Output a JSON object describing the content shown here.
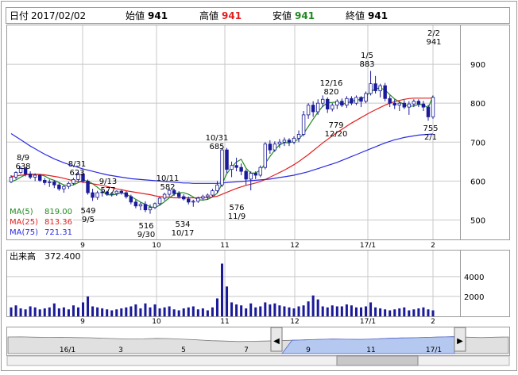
{
  "header": {
    "date_label": "日付",
    "date": "2017/02/02",
    "open_label": "始値",
    "open": "941",
    "high_label": "高値",
    "high": "941",
    "low_label": "安値",
    "low": "941",
    "close_label": "終値",
    "close": "941"
  },
  "colors": {
    "up_candle": "#ffffff",
    "down_candle": "#1a1a9a",
    "candle_outline": "#1a1a9a",
    "ma5": "#1f8a1f",
    "ma25": "#e02020",
    "ma75": "#2a2ae0",
    "volume_bar": "#1a1a9a",
    "high_value": "#e02020",
    "low_value": "#1f8a1f",
    "grid": "#c8c8c8",
    "navigator_fill": "#b4c8f0"
  },
  "chart_data": [
    {
      "type": "candlestick",
      "title": "",
      "ylim": [
        450,
        1000
      ],
      "yticks": [
        "500",
        "600",
        "700",
        "800",
        "900"
      ],
      "xticks": [
        "9",
        "10",
        "11",
        "12",
        "17/1",
        "2"
      ],
      "grid": true,
      "legend_position": "bottom-left",
      "legend": [
        {
          "name": "MA(5)",
          "value": "819.00"
        },
        {
          "name": "MA(25)",
          "value": "813.36"
        },
        {
          "name": "MA(75)",
          "value": "721.31"
        }
      ],
      "ohlc": [
        [
          598,
          615,
          595,
          610
        ],
        [
          610,
          625,
          605,
          622
        ],
        [
          622,
          638,
          618,
          632
        ],
        [
          632,
          636,
          612,
          618
        ],
        [
          618,
          625,
          605,
          610
        ],
        [
          610,
          620,
          600,
          615
        ],
        [
          615,
          618,
          598,
          602
        ],
        [
          602,
          608,
          590,
          596
        ],
        [
          596,
          604,
          585,
          598
        ],
        [
          598,
          602,
          582,
          590
        ],
        [
          590,
          596,
          575,
          580
        ],
        [
          580,
          590,
          570,
          586
        ],
        [
          586,
          598,
          580,
          594
        ],
        [
          594,
          608,
          590,
          604
        ],
        [
          604,
          623,
          600,
          618
        ],
        [
          618,
          622,
          595,
          600
        ],
        [
          600,
          604,
          565,
          570
        ],
        [
          570,
          580,
          549,
          558
        ],
        [
          558,
          575,
          552,
          570
        ],
        [
          570,
          577,
          560,
          572
        ],
        [
          572,
          575,
          562,
          566
        ],
        [
          566,
          572,
          560,
          568
        ],
        [
          568,
          576,
          562,
          574
        ],
        [
          574,
          577,
          565,
          570
        ],
        [
          570,
          574,
          555,
          560
        ],
        [
          560,
          565,
          540,
          546
        ],
        [
          546,
          552,
          530,
          536
        ],
        [
          536,
          545,
          525,
          540
        ],
        [
          540,
          548,
          520,
          526
        ],
        [
          526,
          540,
          516,
          532
        ],
        [
          532,
          545,
          528,
          542
        ],
        [
          542,
          560,
          538,
          556
        ],
        [
          556,
          570,
          550,
          566
        ],
        [
          566,
          582,
          560,
          576
        ],
        [
          576,
          580,
          562,
          568
        ],
        [
          568,
          574,
          555,
          560
        ],
        [
          560,
          566,
          550,
          554
        ],
        [
          554,
          560,
          540,
          546
        ],
        [
          546,
          552,
          534,
          548
        ],
        [
          548,
          560,
          544,
          556
        ],
        [
          556,
          565,
          550,
          560
        ],
        [
          560,
          568,
          552,
          564
        ],
        [
          564,
          580,
          560,
          575
        ],
        [
          575,
          600,
          570,
          590
        ],
        [
          590,
          685,
          585,
          680
        ],
        [
          680,
          685,
          620,
          630
        ],
        [
          630,
          650,
          610,
          640
        ],
        [
          640,
          660,
          625,
          635
        ],
        [
          635,
          645,
          615,
          625
        ],
        [
          625,
          630,
          590,
          605
        ],
        [
          605,
          625,
          576,
          620
        ],
        [
          620,
          625,
          605,
          615
        ],
        [
          615,
          640,
          610,
          635
        ],
        [
          635,
          700,
          630,
          695
        ],
        [
          695,
          705,
          670,
          680
        ],
        [
          680,
          702,
          675,
          695
        ],
        [
          695,
          708,
          685,
          700
        ],
        [
          700,
          712,
          690,
          705
        ],
        [
          705,
          710,
          690,
          700
        ],
        [
          700,
          715,
          695,
          710
        ],
        [
          710,
          730,
          700,
          720
        ],
        [
          720,
          780,
          715,
          770
        ],
        [
          770,
          800,
          760,
          795
        ],
        [
          795,
          805,
          765,
          778
        ],
        [
          778,
          810,
          770,
          800
        ],
        [
          800,
          820,
          790,
          810
        ],
        [
          810,
          815,
          775,
          785
        ],
        [
          785,
          800,
          779,
          795
        ],
        [
          795,
          810,
          785,
          805
        ],
        [
          805,
          812,
          790,
          795
        ],
        [
          795,
          818,
          788,
          812
        ],
        [
          812,
          818,
          795,
          800
        ],
        [
          800,
          820,
          795,
          815
        ],
        [
          815,
          818,
          790,
          805
        ],
        [
          805,
          830,
          800,
          825
        ],
        [
          825,
          883,
          820,
          850
        ],
        [
          850,
          870,
          825,
          832
        ],
        [
          832,
          850,
          815,
          845
        ],
        [
          845,
          852,
          805,
          812
        ],
        [
          812,
          820,
          790,
          800
        ],
        [
          800,
          810,
          785,
          795
        ],
        [
          795,
          805,
          780,
          800
        ],
        [
          800,
          808,
          785,
          790
        ],
        [
          790,
          805,
          770,
          798
        ],
        [
          798,
          810,
          790,
          805
        ],
        [
          805,
          810,
          790,
          798
        ],
        [
          798,
          806,
          780,
          790
        ],
        [
          790,
          796,
          755,
          765
        ],
        [
          765,
          820,
          760,
          815
        ]
      ],
      "series": [
        {
          "name": "MA(5)",
          "values": [
            598,
            603,
            610,
            616,
            618,
            617,
            617,
            613,
            606,
            602,
            596,
            590,
            589,
            590,
            596,
            602,
            600,
            593,
            584,
            574,
            565,
            564,
            566,
            570,
            566,
            560,
            553,
            546,
            540,
            534,
            532,
            538,
            547,
            557,
            566,
            570,
            570,
            566,
            559,
            552,
            551,
            553,
            559,
            569,
            593,
            619,
            636,
            649,
            656,
            633,
            620,
            621,
            628,
            645,
            663,
            680,
            693,
            699,
            698,
            702,
            707,
            722,
            740,
            759,
            777,
            792,
            801,
            802,
            803,
            798,
            800,
            805,
            808,
            810,
            818,
            830,
            837,
            839,
            834,
            822,
            811,
            803,
            797,
            792,
            793,
            797,
            796,
            788,
            819
          ]
        },
        {
          "name": "MA(25)",
          "values": [
            612,
            613,
            615,
            616,
            617,
            617,
            617,
            616,
            614,
            612,
            610,
            607,
            604,
            601,
            599,
            597,
            595,
            593,
            591,
            589,
            586,
            583,
            580,
            578,
            575,
            573,
            571,
            569,
            567,
            565,
            562,
            560,
            559,
            558,
            557,
            557,
            557,
            557,
            557,
            557,
            558,
            558,
            559,
            561,
            566,
            571,
            576,
            581,
            585,
            589,
            592,
            595,
            599,
            604,
            610,
            616,
            622,
            628,
            635,
            642,
            650,
            659,
            668,
            678,
            688,
            698,
            707,
            716,
            725,
            733,
            741,
            749,
            756,
            763,
            770,
            777,
            783,
            789,
            795,
            800,
            804,
            807,
            810,
            812,
            813,
            813,
            813,
            813,
            813
          ]
        },
        {
          "name": "MA(75)",
          "values": [
            722,
            714,
            706,
            698,
            690,
            683,
            676,
            669,
            663,
            657,
            652,
            647,
            643,
            639,
            635,
            631,
            628,
            625,
            622,
            619,
            616,
            614,
            612,
            610,
            608,
            606,
            605,
            604,
            603,
            602,
            601,
            600,
            599,
            598,
            597,
            596,
            595,
            595,
            594,
            594,
            594,
            594,
            594,
            594,
            595,
            596,
            597,
            598,
            599,
            600,
            601,
            602,
            603,
            604,
            605,
            607,
            609,
            611,
            613,
            615,
            618,
            621,
            624,
            628,
            632,
            636,
            640,
            644,
            648,
            653,
            658,
            663,
            668,
            673,
            678,
            683,
            688,
            693,
            698,
            702,
            706,
            709,
            712,
            714,
            716,
            718,
            719,
            720,
            721
          ]
        }
      ],
      "annotations": [
        {
          "date": "8/9",
          "value": "638"
        },
        {
          "date": "8/31",
          "value": "623"
        },
        {
          "date": "9/13",
          "value": "577"
        },
        {
          "date": "9/5",
          "value": "549"
        },
        {
          "date": "9/30",
          "value": "516"
        },
        {
          "date": "10/11",
          "value": "582"
        },
        {
          "date": "10/17",
          "value": "534"
        },
        {
          "date": "10/31",
          "value": "685"
        },
        {
          "date": "11/9",
          "value": "576"
        },
        {
          "date": "12/16",
          "value": "820"
        },
        {
          "date": "12/20",
          "value": "779"
        },
        {
          "date": "1/5",
          "value": "883"
        },
        {
          "date": "2/1",
          "value": "755"
        },
        {
          "date": "2/2",
          "value": "941"
        }
      ]
    },
    {
      "type": "bar",
      "title": "出来高",
      "current_value": "372.400",
      "ylim": [
        0,
        5500
      ],
      "yticks": [
        "2000",
        "4000"
      ],
      "xticks": [
        "9",
        "10",
        "11",
        "12",
        "17/1",
        "2"
      ],
      "values": [
        900,
        1100,
        800,
        700,
        1000,
        900,
        700,
        800,
        900,
        1300,
        800,
        900,
        700,
        1100,
        900,
        1400,
        2000,
        1000,
        900,
        800,
        700,
        600,
        700,
        800,
        900,
        1000,
        1200,
        800,
        1300,
        900,
        1200,
        800,
        900,
        1000,
        700,
        600,
        800,
        900,
        1000,
        700,
        800,
        600,
        900,
        1800,
        5300,
        3000,
        1400,
        1200,
        1100,
        800,
        1300,
        900,
        1000,
        1400,
        1200,
        1300,
        1100,
        1000,
        900,
        800,
        1000,
        1100,
        1500,
        2100,
        1700,
        1000,
        900,
        1100,
        1000,
        1000,
        1200,
        1100,
        900,
        900,
        1000,
        1400,
        900,
        800,
        700,
        600,
        700,
        800,
        900,
        600,
        700,
        800,
        900,
        700,
        600
      ]
    },
    {
      "type": "area",
      "title": "",
      "xticks": [
        "16/1",
        "3",
        "5",
        "7",
        "9",
        "11",
        "17/1"
      ],
      "values": [
        900,
        905,
        890,
        880,
        885,
        870,
        860,
        840,
        820,
        800,
        810,
        830,
        820,
        790,
        760,
        720,
        700,
        680,
        690,
        700,
        720,
        740,
        760,
        780,
        800,
        790,
        780,
        800,
        830,
        850,
        860,
        880,
        900,
        910,
        890,
        870,
        890,
        900
      ]
    }
  ],
  "navigator": {
    "left_arrow": "◀",
    "right_arrow": "▶"
  }
}
